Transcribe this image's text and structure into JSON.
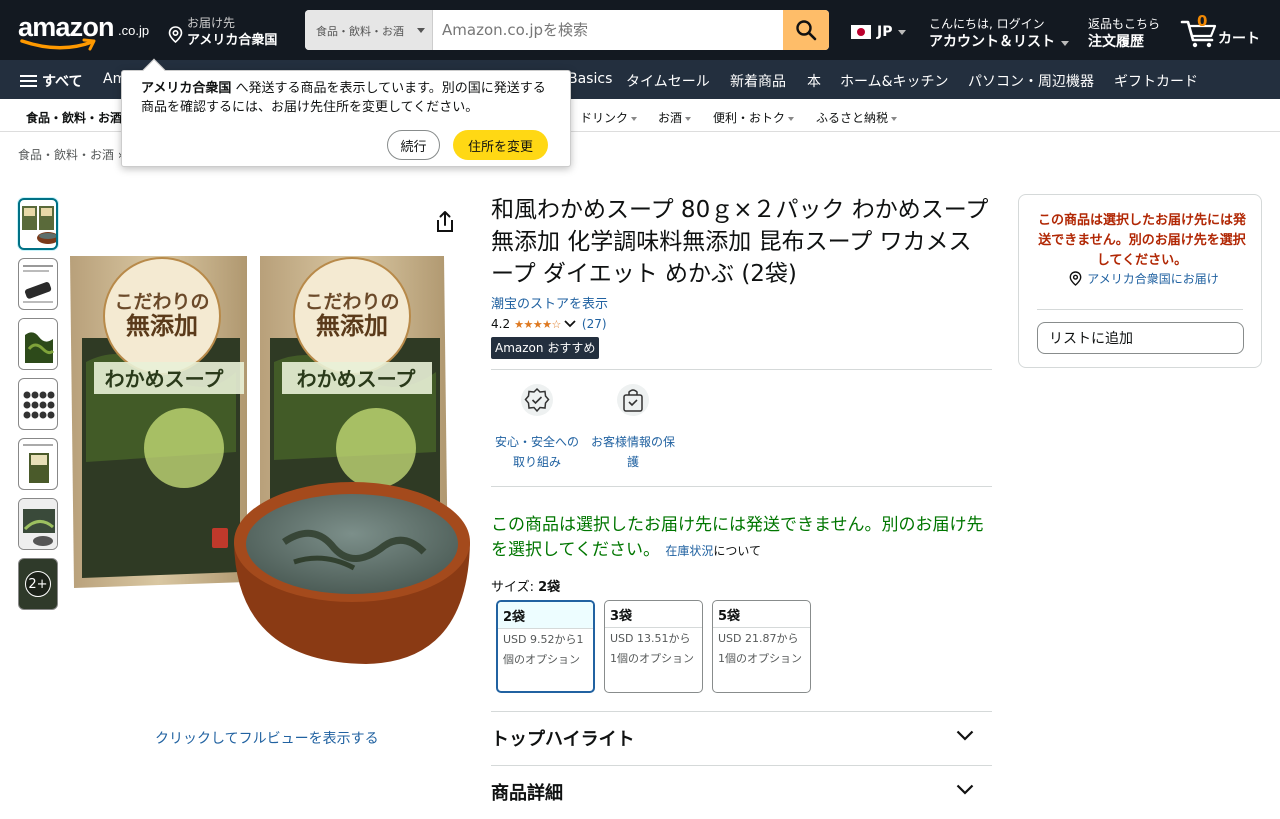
{
  "header": {
    "logo_text": "amazon",
    "logo_suffix": ".co.jp",
    "deliver_line1": "お届け先",
    "deliver_line2": "アメリカ合衆国",
    "search_category": "食品・飲料・お酒",
    "search_placeholder": "Amazon.co.jpを検索",
    "lang_label": "JP",
    "account_line1": "こんにちは, ログイン",
    "account_line2": "アカウント＆リスト",
    "orders_line1": "返品もこちら",
    "orders_line2": "注文履歴",
    "cart_count": "0",
    "cart_label": "カート"
  },
  "nav": {
    "all_label": "すべて",
    "partial_first": "Am",
    "items": [
      "Basics",
      "タイムセール",
      "新着商品",
      "本",
      "ホーム&キッチン",
      "パソコン・周辺機器",
      "ギフトカード"
    ]
  },
  "subnav": {
    "first": "食品・飲料・お酒",
    "items": [
      "ドリンク",
      "お酒",
      "便利・おトク",
      "ふるさと納税"
    ]
  },
  "breadcrumb": "食品・飲料・お酒 ›",
  "popover": {
    "country": "アメリカ合衆国",
    "message": " へ発送する商品を表示しています。別の国に発送する商品を確認するには、お届け先住所を変更してください。",
    "continue_label": "続行",
    "change_label": "住所を変更"
  },
  "gallery": {
    "more_label": "2+",
    "full_view_link": "クリックしてフルビューを表示する"
  },
  "product": {
    "title": "和風わかめスープ 80ｇ×２パック わかめスープ 無添加 化学調味料無添加 昆布スープ ワカメスープ ダイエット めかぶ (2袋)",
    "store_link": "潮宝のストアを表示",
    "rating": "4.2",
    "rating_value": 4.2,
    "rating_count": "(27)",
    "badge": "Amazon おすすめ",
    "features": [
      {
        "label": "安心・安全への取り組み",
        "icon": "safety-badge-icon"
      },
      {
        "label": "お客様情報の保護",
        "icon": "secure-bag-icon"
      }
    ],
    "availability": "この商品は選択したお届け先には発送できません。別のお届け先を選択してください。",
    "stock_link": "在庫状況",
    "stock_suffix": "について",
    "size_label": "サイズ: ",
    "size_selected": "2袋",
    "sizes": [
      {
        "name": "2袋",
        "price": "USD 9.52から1個のオプション"
      },
      {
        "name": "3袋",
        "price": "USD 13.51から1個のオプション"
      },
      {
        "name": "5袋",
        "price": "USD 21.87から1個のオプション"
      }
    ],
    "sections": [
      "トップハイライト",
      "商品詳細"
    ]
  },
  "buybox": {
    "warning": "この商品は選択したお届け先には発送できません。別のお届け先を選択してください。",
    "ship_to": "アメリカ合衆国にお届け",
    "add_to_list": "リストに追加"
  },
  "colors": {
    "header_bg": "#131921",
    "nav_bg": "#232f3e",
    "search_button": "#febd69",
    "primary_button": "#ffd814",
    "link": "#2162a1",
    "stars": "#de7921",
    "availability": "#007600",
    "warning": "#b12704"
  }
}
